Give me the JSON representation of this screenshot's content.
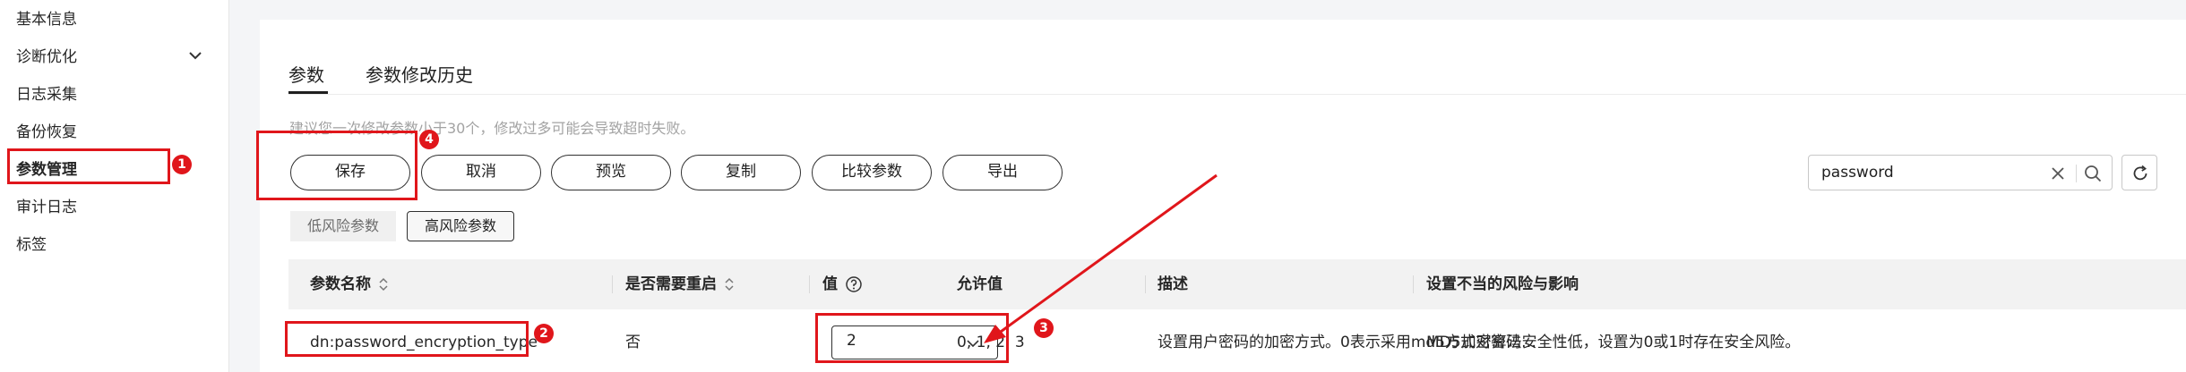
{
  "sidebar": {
    "items": [
      {
        "label": "基本信息"
      },
      {
        "label": "诊断优化"
      },
      {
        "label": "日志采集"
      },
      {
        "label": "备份恢复"
      },
      {
        "label": "参数管理"
      },
      {
        "label": "审计日志"
      },
      {
        "label": "标签"
      }
    ],
    "active": "参数管理"
  },
  "tabs": [
    {
      "label": "参数",
      "active": true
    },
    {
      "label": "参数修改历史",
      "active": false
    }
  ],
  "hint": "建议您一次修改参数小于30个，修改过多可能会导致超时失败。",
  "toolbar": {
    "buttons": [
      "保存",
      "取消",
      "预览",
      "复制",
      "比较参数",
      "导出"
    ]
  },
  "search": {
    "value": "password"
  },
  "risk_filter": {
    "options": [
      "低风险参数",
      "高风险参数"
    ],
    "selected": "高风险参数"
  },
  "table": {
    "headers": [
      "参数名称",
      "是否需要重启",
      "值",
      "允许值",
      "描述",
      "设置不当的风险与影响"
    ],
    "rows": [
      {
        "name": "dn:password_encryption_type",
        "restart": "否",
        "value": "2",
        "allowed": "0, 1, 2, 3",
        "description": "设置用户密码的加密方式。0表示采用md5方式对密码…",
        "risk": "MD5加密算法安全性低，设置为0或1时存在安全风险。"
      }
    ]
  },
  "annotations": {
    "badges": [
      "1",
      "2",
      "3",
      "4"
    ],
    "color": "#e0161b"
  },
  "icons": {
    "chevron": "chevron-down-icon",
    "sort": "sort-icon",
    "help": "help-circle-icon",
    "clear": "close-icon",
    "search": "search-icon",
    "refresh": "refresh-icon",
    "select_chevron": "chevron-down-icon"
  }
}
